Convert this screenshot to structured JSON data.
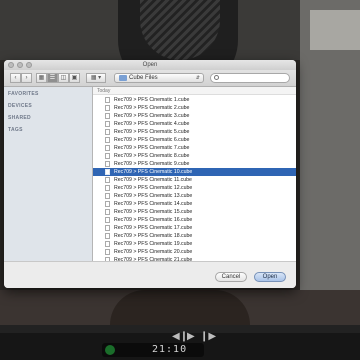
{
  "dialog": {
    "title": "Open",
    "location": "Cube Files",
    "sidebar_sections": [
      "FAVORITES",
      "DEVICES",
      "SHARED",
      "TAGS"
    ],
    "list_group": "Today",
    "files": [
      "Rec709 > PFS Cinematic 1.cube",
      "Rec709 > PFS Cinematic 2.cube",
      "Rec709 > PFS Cinematic 3.cube",
      "Rec709 > PFS Cinematic 4.cube",
      "Rec709 > PFS Cinematic 5.cube",
      "Rec709 > PFS Cinematic 6.cube",
      "Rec709 > PFS Cinematic 7.cube",
      "Rec709 > PFS Cinematic 8.cube",
      "Rec709 > PFS Cinematic 9.cube",
      "Rec709 > PFS Cinematic 10.cube",
      "Rec709 > PFS Cinematic 11.cube",
      "Rec709 > PFS Cinematic 12.cube",
      "Rec709 > PFS Cinematic 13.cube",
      "Rec709 > PFS Cinematic 14.cube",
      "Rec709 > PFS Cinematic 15.cube",
      "Rec709 > PFS Cinematic 16.cube",
      "Rec709 > PFS Cinematic 17.cube",
      "Rec709 > PFS Cinematic 18.cube",
      "Rec709 > PFS Cinematic 19.cube",
      "Rec709 > PFS Cinematic 20.cube",
      "Rec709 > PFS Cinematic 21.cube"
    ],
    "selected_index": 9,
    "cancel_label": "Cancel",
    "open_label": "Open"
  },
  "player": {
    "timecode": "21:10"
  },
  "colors": {
    "selection": "#2f65b4",
    "sidebar": "#dfe4ea"
  }
}
